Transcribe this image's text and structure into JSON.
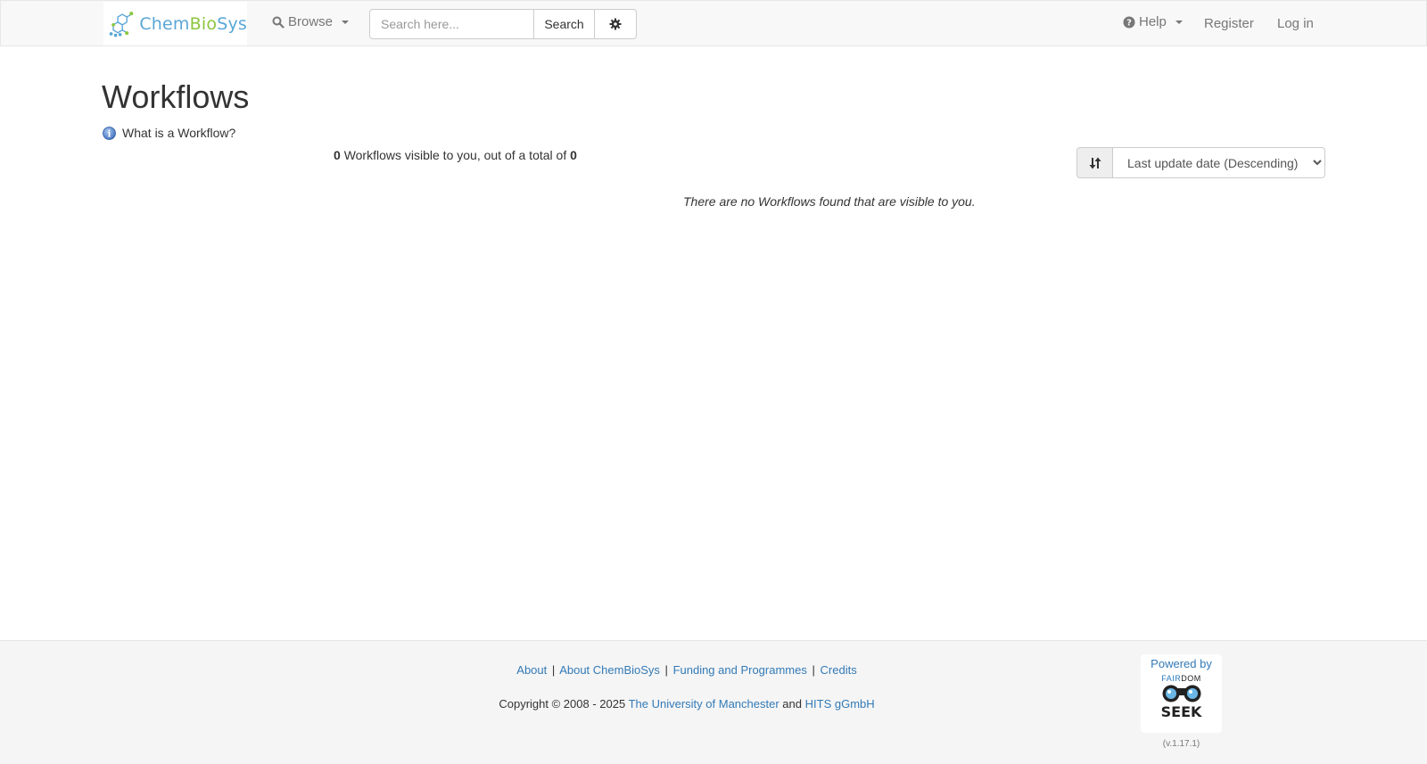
{
  "nav": {
    "brand": {
      "chem": "Chem",
      "bio": "Bio",
      "sys": "Sys"
    },
    "browse_label": "Browse",
    "search_placeholder": "Search here...",
    "search_button": "Search",
    "help_label": "Help",
    "register_label": "Register",
    "login_label": "Log in",
    "icons": {
      "browse": "search-icon",
      "advanced": "gear-icon",
      "help": "question-circle-icon"
    }
  },
  "main": {
    "title": "Workflows",
    "info_link": "What is a Workflow?",
    "visible_count": "0",
    "count_text_middle": "Workflows visible to you, out of a total of",
    "total_count": "0",
    "sort_selected": "Last update date (Descending)",
    "empty_message": "There are no Workflows found that are visible to you."
  },
  "footer": {
    "links": [
      "About",
      "About ChemBioSys",
      "Funding and Programmes",
      "Credits"
    ],
    "separator": "|",
    "copyright_prefix": "Copyright © 2008 - 2025",
    "org1": "The University of Manchester",
    "and_text": "and",
    "org2": "HITS gGmbH",
    "powered_by": "Powered by",
    "fair": "FAIR",
    "dom": "DOM",
    "seek": "SEEK",
    "version": "(v.1.17.1)"
  },
  "colors": {
    "link": "#337ab7",
    "navbar_bg": "#f8f8f8",
    "footer_bg": "#f5f5f5",
    "brand_blue": "#5aa7d6",
    "brand_green": "#8cc63f"
  }
}
